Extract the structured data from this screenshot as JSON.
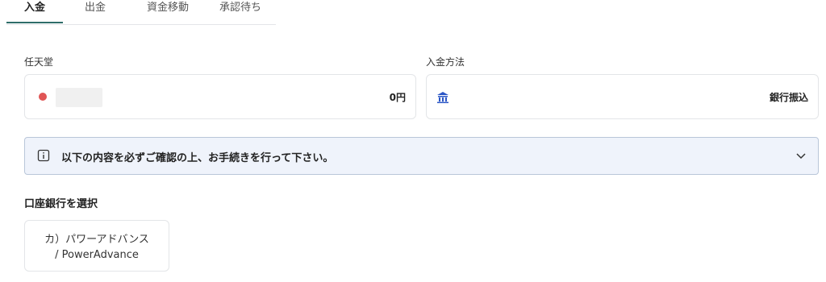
{
  "tabs": [
    {
      "label": "入金",
      "active": true
    },
    {
      "label": "出金",
      "active": false
    },
    {
      "label": "資金移動",
      "active": false
    },
    {
      "label": "承認待ち",
      "active": false
    }
  ],
  "account": {
    "label": "任天堂",
    "amount": "0円",
    "status_icon": "red-dot",
    "status_color": "#e05555"
  },
  "deposit_method": {
    "label": "入金方法",
    "value": "銀行振込",
    "icon": "bank-icon",
    "icon_color": "#2a56c6"
  },
  "notice": {
    "text": "以下の内容を必ずご確認の上、お手続きを行って下さい。",
    "icon": "info-icon",
    "toggle_icon": "chevron-down-icon"
  },
  "bank_selection": {
    "title": "口座銀行を選択",
    "options": [
      {
        "line1": "カ）パワーアドバンス",
        "line2": "/ PowerAdvance"
      }
    ]
  },
  "colors": {
    "accent": "#2f6e6a",
    "notice_bg": "#eff3fb",
    "notice_border": "#b9c6d9"
  }
}
